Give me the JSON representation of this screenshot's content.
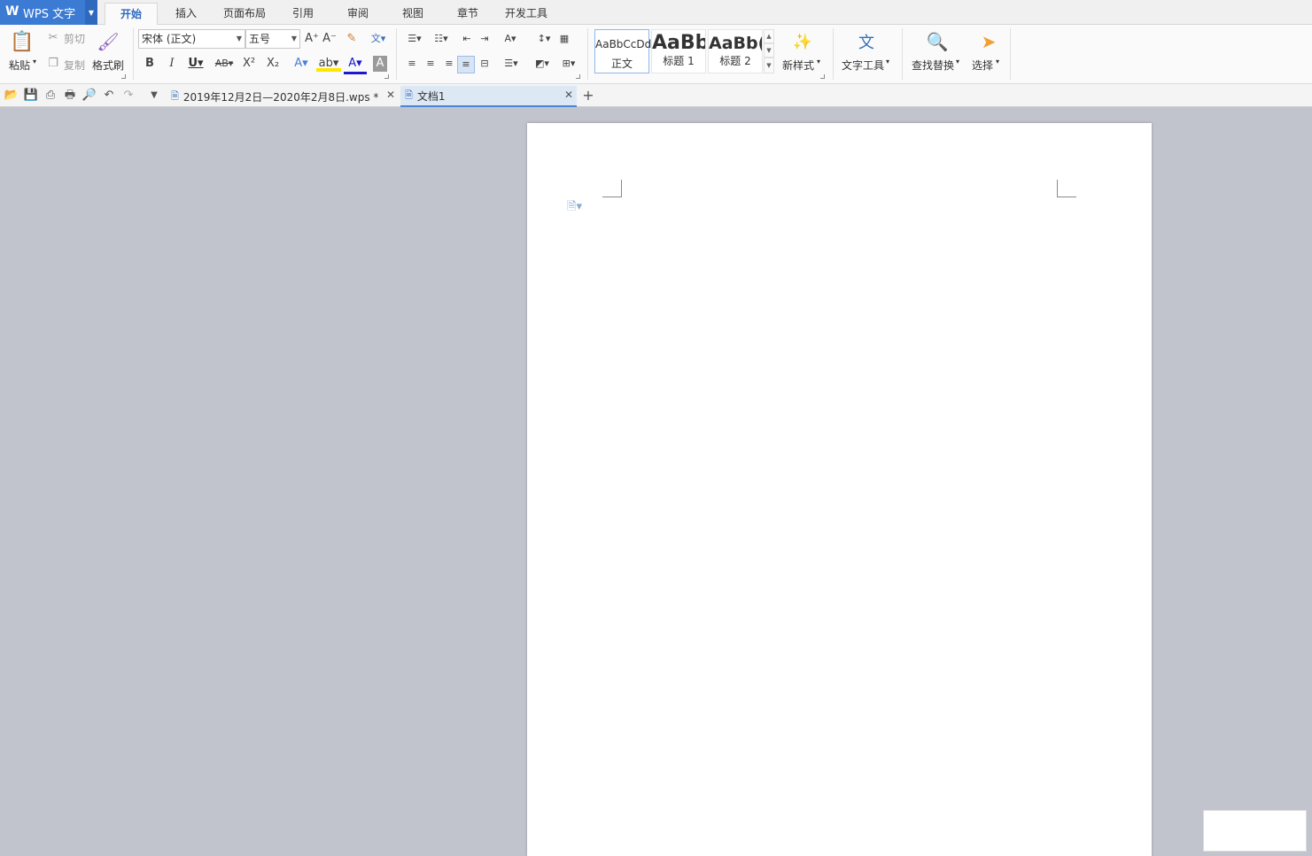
{
  "app": {
    "title": "WPS 文字",
    "logo": "W"
  },
  "menu_tabs": [
    "开始",
    "插入",
    "页面布局",
    "引用",
    "审阅",
    "视图",
    "章节",
    "开发工具"
  ],
  "ribbon": {
    "clipboard": {
      "paste": "粘贴",
      "cut": "剪切",
      "copy": "复制",
      "format_painter": "格式刷"
    },
    "font": {
      "font_name": "宋体 (正文)",
      "font_size": "五号"
    },
    "styles": {
      "items": [
        {
          "preview": "AaBbCcDd",
          "name": "正文"
        },
        {
          "preview": "AaBb",
          "name": "标题 1"
        },
        {
          "preview": "AaBb(",
          "name": "标题 2"
        }
      ],
      "new_style": "新样式"
    },
    "text_tools": "文字工具",
    "find_replace": "查找替换",
    "select": "选择"
  },
  "doc_tabs": [
    {
      "label": "2019年12月2日—2020年2月8日.wps *"
    },
    {
      "label": "文档1"
    }
  ],
  "colors": {
    "accent": "#3c7bd4",
    "workspace": "#c1c4cc",
    "page": "#ffffff"
  }
}
